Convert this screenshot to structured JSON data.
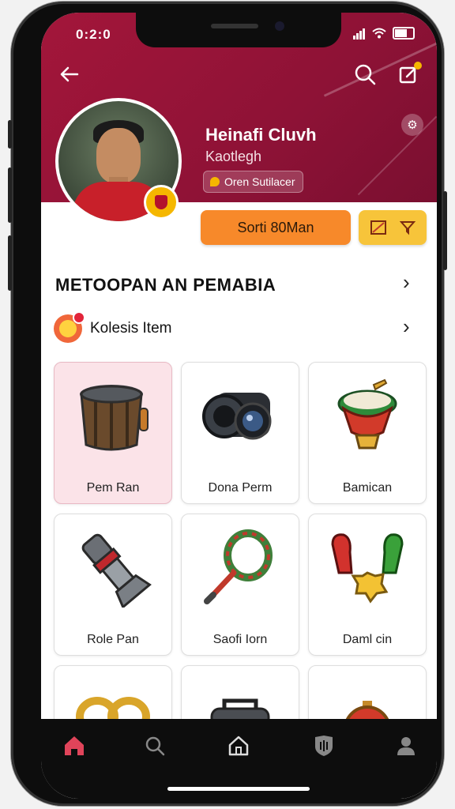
{
  "status_bar": {
    "time": "0:2:0"
  },
  "profile": {
    "name": "Heinafi Cluvh",
    "handle": "Kaotlegh",
    "chip_label": "Oren Sutilacer"
  },
  "actions": {
    "primary_label": "Sorti 80Man"
  },
  "section": {
    "title": "METOOPAN AN PEMABIA"
  },
  "collection": {
    "label": "Kolesis Item"
  },
  "items": [
    {
      "label": "Pem Ran",
      "icon": "barrel-icon",
      "selected": true
    },
    {
      "label": "Dona Perm",
      "icon": "camera-icon",
      "selected": false
    },
    {
      "label": "Bamican",
      "icon": "bowl-icon",
      "selected": false
    },
    {
      "label": "Role Pan",
      "icon": "horn-icon",
      "selected": false
    },
    {
      "label": "Saofi Iorn",
      "icon": "rope-racket-icon",
      "selected": false
    },
    {
      "label": "Daml cin",
      "icon": "charms-icon",
      "selected": false
    }
  ],
  "bottom_nav": [
    "home-icon",
    "search-icon",
    "house-icon",
    "shield-icon",
    "profile-icon"
  ],
  "colors": {
    "header": "#a3163a",
    "primary_button": "#f7892a",
    "secondary_button": "#f7c43a",
    "nav_active": "#e0445a"
  }
}
